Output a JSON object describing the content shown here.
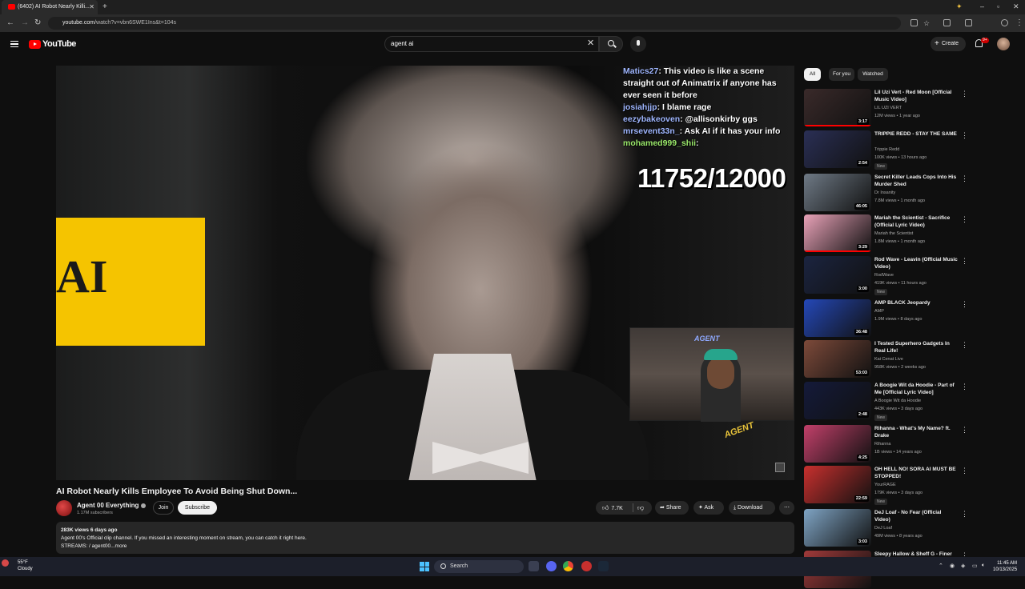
{
  "browser": {
    "tab_title": "(6402) AI Robot Nearly Killi...",
    "url_host": "youtube.com",
    "url_path": "/watch?v=vbn6SWE1Ins&t=104s"
  },
  "header": {
    "logo_text": "YouTube",
    "search_value": "agent ai",
    "create_label": "Create",
    "notification_count": "9+"
  },
  "player": {
    "sign_text": "AI",
    "chat": [
      {
        "user": "Matics27",
        "text": ": This video is like a scene straight out of Animatrix if anyone has ever seen it before"
      },
      {
        "user": "josiahjjp",
        "text": ": I blame rage"
      },
      {
        "user": "eezybakeoven",
        "text": ": @allisonkirby ggs"
      },
      {
        "user": "mrsevent33n_",
        "text": ": Ask AI if it has your info"
      },
      {
        "user": "mohamed999_shii",
        "text": ":"
      }
    ],
    "counter": "11752/12000",
    "webcam_sign": "AGENT",
    "overlay_logo": "AGENT"
  },
  "video": {
    "title": "AI Robot Nearly Kills Employee To Avoid Being Shut Down...",
    "channel": "Agent 00 Everything",
    "subscribers": "1.17M subscribers",
    "join_label": "Join",
    "subscribe_label": "Subscribe",
    "likes": "7.7K",
    "share_label": "Share",
    "ask_label": "Ask",
    "download_label": "Download",
    "more_label": "⋯",
    "desc_stats": "283K views  6 days ago",
    "desc_line": "Agent 00's Official clip channel. If you missed an interesting moment on stream, you can catch it right here.",
    "desc_streams": "STREAMS: / agent00...more"
  },
  "sidebar": {
    "chips": [
      "All",
      "For you",
      "Watched"
    ],
    "recs": [
      {
        "title": "Lil Uzi Vert - Red Moon [Official Music Video]",
        "channel": "LIL UZI VERT",
        "meta": "12M views • 1 year ago",
        "duration": "3:17",
        "new": "",
        "progress": 1.0,
        "color": "#3a2a2a"
      },
      {
        "title": "TRIPPIE REDD - STAY THE SAME",
        "channel": "Trippie Redd",
        "meta": "100K views • 13 hours ago",
        "duration": "2:54",
        "new": "New",
        "progress": 0.0,
        "color": "#2a2f55"
      },
      {
        "title": "Secret Killer Leads Cops Into His Murder Shed",
        "channel": "Dr Insanity",
        "meta": "7.8M views • 1 month ago",
        "duration": "46:05",
        "new": "",
        "progress": 0.0,
        "color": "#6f7a86"
      },
      {
        "title": "Mariah the Scientist - Sacrifice (Official Lyric Video)",
        "channel": "Mariah the Scientist",
        "meta": "1.8M views • 1 month ago",
        "duration": "3:29",
        "new": "",
        "progress": 1.0,
        "color": "#e9a2b8"
      },
      {
        "title": "Rod Wave - Leavin (Official Music Video)",
        "channel": "RodWave",
        "meta": "419K views • 11 hours ago",
        "duration": "3:00",
        "new": "New",
        "progress": 0.0,
        "color": "#1b2440"
      },
      {
        "title": "AMP BLACK Jeopardy",
        "channel": "AMP",
        "meta": "1.9M views • 8 days ago",
        "duration": "36:48",
        "new": "",
        "progress": 0.0,
        "color": "#2448b8"
      },
      {
        "title": "I Tested Superhero Gadgets In Real Life!",
        "channel": "Kai Cenat Live",
        "meta": "958K views • 2 weeks ago",
        "duration": "53:03",
        "new": "",
        "progress": 0.0,
        "color": "#7d4a3a"
      },
      {
        "title": "A Boogie Wit da Hoodie - Part of Me [Official Lyric Video]",
        "channel": "A Boogie Wit da Hoodie",
        "meta": "443K views • 3 days ago",
        "duration": "2:48",
        "new": "New",
        "progress": 0.0,
        "color": "#141a3a"
      },
      {
        "title": "Rihanna - What's My Name? ft. Drake",
        "channel": "Rihanna",
        "meta": "1B views • 14 years ago",
        "duration": "4:25",
        "new": "",
        "progress": 0.0,
        "color": "#c2406a"
      },
      {
        "title": "OH HELL NO! SORA AI MUST BE STOPPED!",
        "channel": "YourRAGE",
        "meta": "179K views • 3 days ago",
        "duration": "22:59",
        "new": "New",
        "progress": 0.0,
        "color": "#c8302e"
      },
      {
        "title": "DeJ Loaf - No Fear (Official Video)",
        "channel": "DeJ Loaf",
        "meta": "49M views • 8 years ago",
        "duration": "3:03",
        "new": "",
        "progress": 0.0,
        "color": "#7fa4c4"
      },
      {
        "title": "Sleepy Hallow & Sheff G - Finer",
        "channel": "",
        "meta": "",
        "duration": "",
        "new": "",
        "progress": 0.0,
        "color": "#a03a3a"
      }
    ]
  },
  "taskbar": {
    "temp": "55°F",
    "weather": "Cloudy",
    "search_label": "Search",
    "time": "11:45 AM",
    "date": "10/13/2025"
  }
}
